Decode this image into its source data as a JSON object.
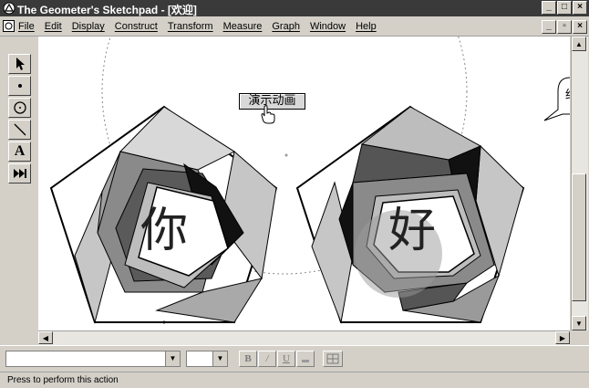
{
  "window": {
    "title": "The Geometer's Sketchpad - [欢迎]"
  },
  "menu": [
    "File",
    "Edit",
    "Display",
    "Construct",
    "Transform",
    "Measure",
    "Graph",
    "Window",
    "Help"
  ],
  "toolbox": {
    "text_tool_label": "A"
  },
  "canvas": {
    "button_label": "演示动画",
    "char_left": "你",
    "char_right": "好",
    "callout_char": "结"
  },
  "status": {
    "text": "Press to perform this action"
  },
  "textbar": {
    "bold": "B",
    "italic": "/",
    "underline": "U"
  }
}
